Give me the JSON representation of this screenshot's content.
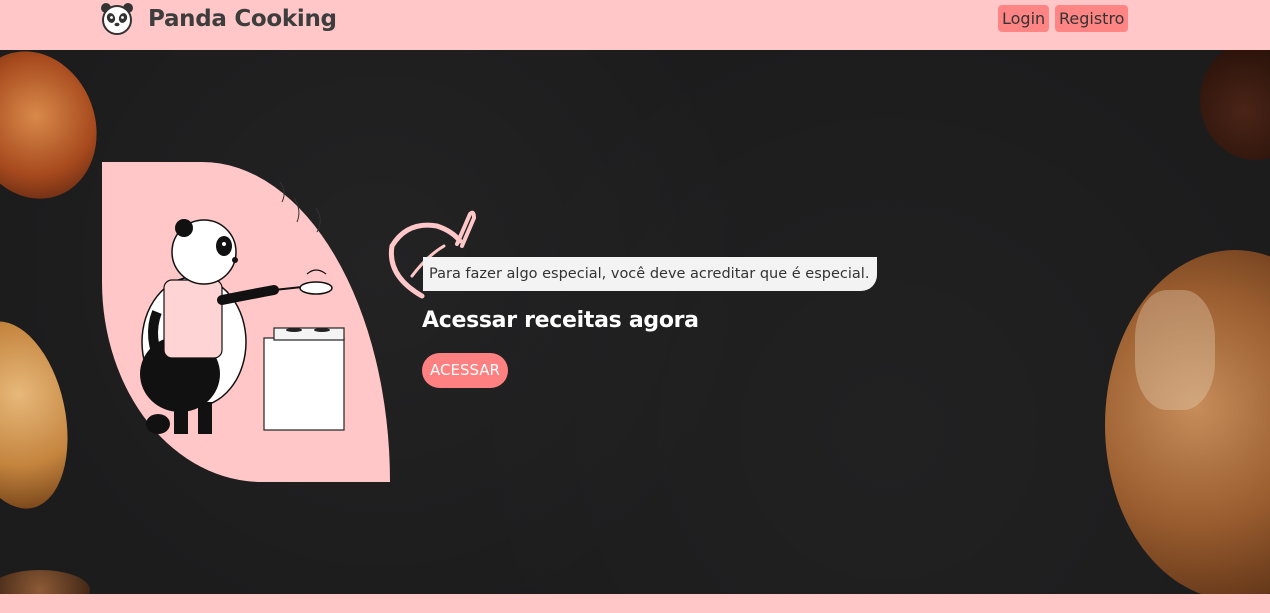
{
  "navbar": {
    "brand": "Panda Cooking",
    "logo_icon": "panda-face-icon",
    "login_label": "Login",
    "register_label": "Registro"
  },
  "hero": {
    "quote": "Para fazer algo especial, você deve acreditar que é especial.",
    "cta_title": "Acessar receitas agora",
    "access_button": "ACESSAR",
    "illustration": "panda-cooking-illustration",
    "decoration_icon": "leaf-outline-icon"
  },
  "colors": {
    "navbar_bg": "#ffc7c7",
    "accent": "#ff8585",
    "hero_bg": "#1c1c1d"
  }
}
